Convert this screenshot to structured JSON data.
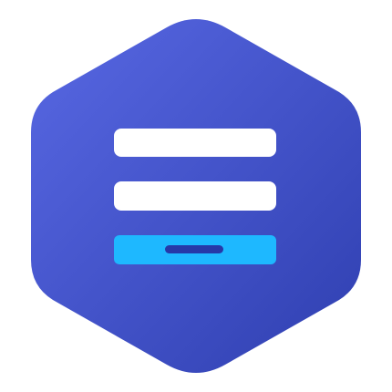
{
  "logo": {
    "icon": "form-hexagon-icon",
    "colors": {
      "hexagon_gradient_start": "#5868E3",
      "hexagon_gradient_end": "#2F3FB0",
      "field_fill": "#FFFFFF",
      "submit_fill": "#1EB8FF",
      "submit_line": "#2638A8"
    }
  }
}
